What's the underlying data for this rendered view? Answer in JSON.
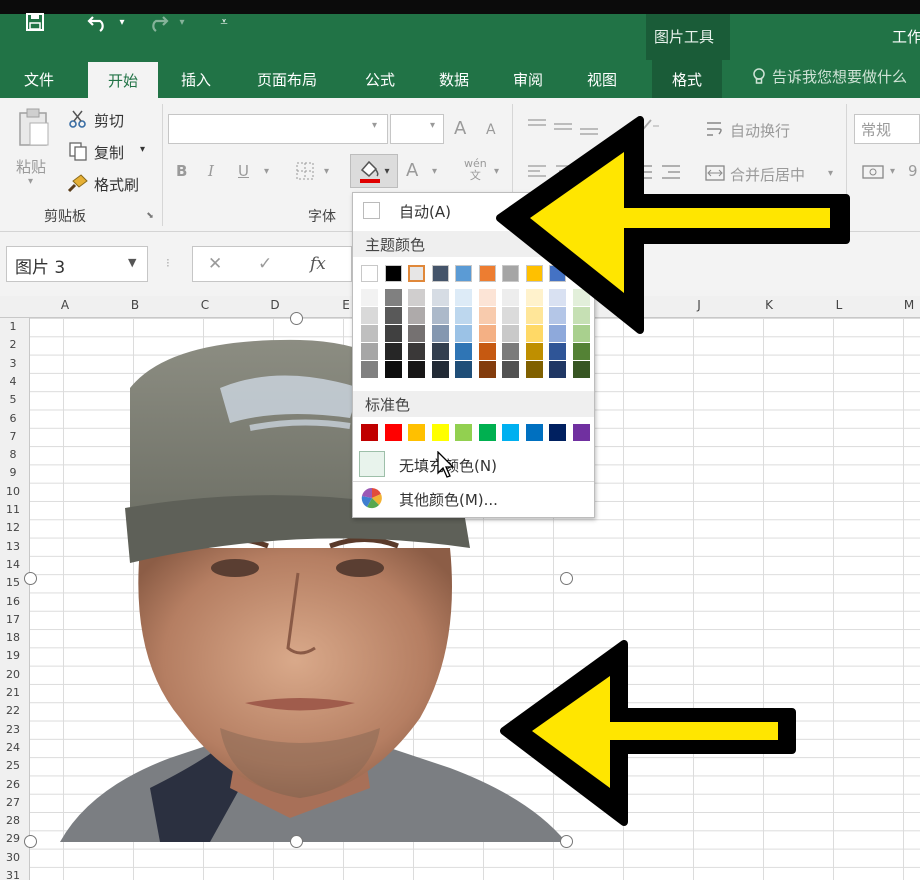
{
  "titlebar": {
    "picture_tools": "图片工具",
    "app_title": "工作"
  },
  "tabs": [
    {
      "label": "文件"
    },
    {
      "label": "开始"
    },
    {
      "label": "插入"
    },
    {
      "label": "页面布局"
    },
    {
      "label": "公式"
    },
    {
      "label": "数据"
    },
    {
      "label": "审阅"
    },
    {
      "label": "视图"
    },
    {
      "label": "格式"
    }
  ],
  "tell_me": "告诉我您想要做什么",
  "clipboard": {
    "paste": "粘贴",
    "cut": "剪切",
    "copy": "复制",
    "format_painter": "格式刷",
    "group_label": "剪贴板"
  },
  "font": {
    "group_label": "字体",
    "bold": "B",
    "italic": "I",
    "underline": "U",
    "grow": "A",
    "shrink": "A",
    "font_color": "A",
    "phonetic": "wén\n文"
  },
  "alignment": {
    "wrap_text": "自动换行",
    "merge_center": "合并后居中"
  },
  "number": {
    "format": "常规",
    "digit": "9"
  },
  "formula_bar": {
    "name_box": "图片 3",
    "fx": "fx",
    "cancel": "✕",
    "enter": "✓"
  },
  "columns": [
    "A",
    "B",
    "C",
    "D",
    "E",
    "J",
    "K",
    "L",
    "M"
  ],
  "rows": [
    "1",
    "2",
    "3",
    "4",
    "5",
    "6",
    "7",
    "8",
    "9",
    "10",
    "11",
    "12",
    "13",
    "14",
    "15",
    "16",
    "17",
    "18",
    "19",
    "20",
    "21",
    "22",
    "23",
    "24",
    "25",
    "26",
    "27",
    "28",
    "29",
    "30",
    "31"
  ],
  "fill_menu": {
    "automatic": "自动(A)",
    "theme_colors_label": "主题颜色",
    "standard_colors_label": "标准色",
    "no_fill": "无填充颜色(N)",
    "more_colors": "其他颜色(M)...",
    "theme_top": [
      "#ffffff",
      "#000000",
      "#e7e6e6",
      "#44546a",
      "#5b9bd5",
      "#ed7d31",
      "#a5a5a5",
      "#ffc000",
      "#4472c4",
      "#70ad47"
    ],
    "theme_shades": [
      [
        "#f2f2f2",
        "#d9d9d9",
        "#bfbfbf",
        "#a6a6a6",
        "#808080"
      ],
      [
        "#808080",
        "#595959",
        "#404040",
        "#262626",
        "#0d0d0d"
      ],
      [
        "#d0cece",
        "#aeaaaa",
        "#757171",
        "#3a3838",
        "#171616"
      ],
      [
        "#d6dce4",
        "#acb9ca",
        "#8497b0",
        "#333f4f",
        "#222a35"
      ],
      [
        "#ddebf7",
        "#bdd7ee",
        "#9bc2e6",
        "#2f75b5",
        "#1f4e78"
      ],
      [
        "#fce4d6",
        "#f8cbad",
        "#f4b084",
        "#c65911",
        "#833c0c"
      ],
      [
        "#ededed",
        "#dbdbdb",
        "#c9c9c9",
        "#7b7b7b",
        "#525252"
      ],
      [
        "#fff2cc",
        "#ffe699",
        "#ffd966",
        "#bf8f00",
        "#806000"
      ],
      [
        "#d9e1f2",
        "#b4c6e7",
        "#8ea9db",
        "#2f5597",
        "#203764"
      ],
      [
        "#e2efda",
        "#c6e0b4",
        "#a9d08e",
        "#548235",
        "#375623"
      ]
    ],
    "standard": [
      "#c00000",
      "#ff0000",
      "#ffc000",
      "#ffff00",
      "#92d050",
      "#00b050",
      "#00b0f0",
      "#0070c0",
      "#002060",
      "#7030a0"
    ]
  },
  "colors": {
    "excel_green": "#217346",
    "annotation_arrow": "#ffe600"
  }
}
